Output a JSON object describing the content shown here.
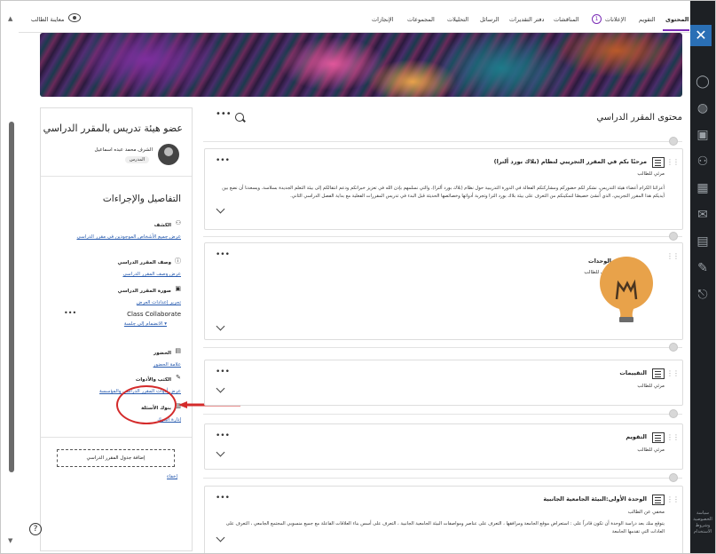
{
  "topnav": {
    "items": [
      "المحتوى",
      "التقويم",
      "الإعلانات",
      "المناقشات",
      "دفتر التقديرات",
      "الرسائل",
      "التحليلات",
      "المجموعات",
      "الإنجازات"
    ],
    "badge": "1",
    "student_preview": "معاينة الطالب"
  },
  "right_bar": {
    "close": "✕",
    "text": "سياسة الخصوصية وشروط الاستخدام"
  },
  "left_panel": {
    "faculty_title": "عضو هيئة تدريس بالمقرر الدراسي",
    "instructor_name": "الشرف محمد عبده اسماعيل",
    "instructor_role": "المدرس",
    "details_heading": "التفاصيل والإجراءات",
    "roster": {
      "title": "الكشف",
      "link": "عرض جميع الأشخاص الموجودين في مقرر الدراسي"
    },
    "description": {
      "title": "وصف المقرر الدراسي",
      "link": "عرض وصف المقرر الدراسي"
    },
    "image": {
      "title": "صورة المقرر الدراسي",
      "link": "تحرير إعدادات العرض"
    },
    "collaborate": {
      "title": "Class Collaborate",
      "link": "الانضمام إلى جلسة ▾"
    },
    "attendance": {
      "title": "الحضور",
      "link": "علامة الحضور"
    },
    "tools": {
      "title": "الكتب والأدوات",
      "link": "عرض أدوات المقرر الدراسي والمؤسسة"
    },
    "question_banks": {
      "title": "بنوك الأسئلة",
      "link": "إدارة البنوك"
    },
    "add_schedule": "إضافة جدول المقرر الدراسي",
    "hide": "إخفاء"
  },
  "main": {
    "title": "محتوى المقرر الدراسي",
    "cards": [
      {
        "title": "مرحبًا بكم في المقرر التجريبي لنظام (بلاك بورد ألترا)",
        "visibility": "مرئي للطالب",
        "body": "أعزائنا الكرام أعضاء هيئة التدريس، نشكر لكم حضوركم ومشاركتكم الفعالة في الدورة التدريبية حول نظام (بلاك بورد ألترا)، والتي نسلمهم بإذن الله في تعزيز خبراتكم ودعم انتقالكم إلى بيئة التعلم الجديدة بسلاسة. ويسعدنا أن نضع بين أيديكم هذا المقرر التجريبي، الذي أُنشئ خصيصًا لتمكينكم من التعرف على بيئة بلاك بورد الترا وتجربة أدواتها وخصائصها الحديثة قبل البدء في تدريس المقررات الفعلية مع بداية الفصل الدراسي الثاني."
      },
      {
        "title": "الوحدات",
        "visibility": "مرئي للطالب"
      },
      {
        "title": "التقييمات",
        "visibility": "مرئي للطالب"
      },
      {
        "title": "التقويم",
        "visibility": "مرئي للطالب"
      },
      {
        "title": "الوحدة الأولى:البيئة الجامعية الجانبية",
        "visibility": "مخفي عن الطالب",
        "body": "يتوقع منك بعد دراسة الوحدة أن تكون قادراً على : استعراض موقع الجامعة ومرافقها ، التعرف على عناصر ومواصفات البيئة الجامعية الجانبية ، التعرف على أسس بناء العلاقات الفاعلة مع جميع منسوبي المجتمع الجامعي ، التعرف على العادات التي تقدمها الجامعة"
      }
    ]
  },
  "colors": {
    "accent": "#7a2bb5",
    "link": "#2a5db0",
    "annotation": "#d42b2b",
    "sidebar": "#1d2024"
  },
  "icons": [
    "close-icon",
    "search-icon",
    "eye-icon",
    "drag-handle-icon",
    "document-icon",
    "folder-icon",
    "lightbulb-icon",
    "help-icon"
  ]
}
